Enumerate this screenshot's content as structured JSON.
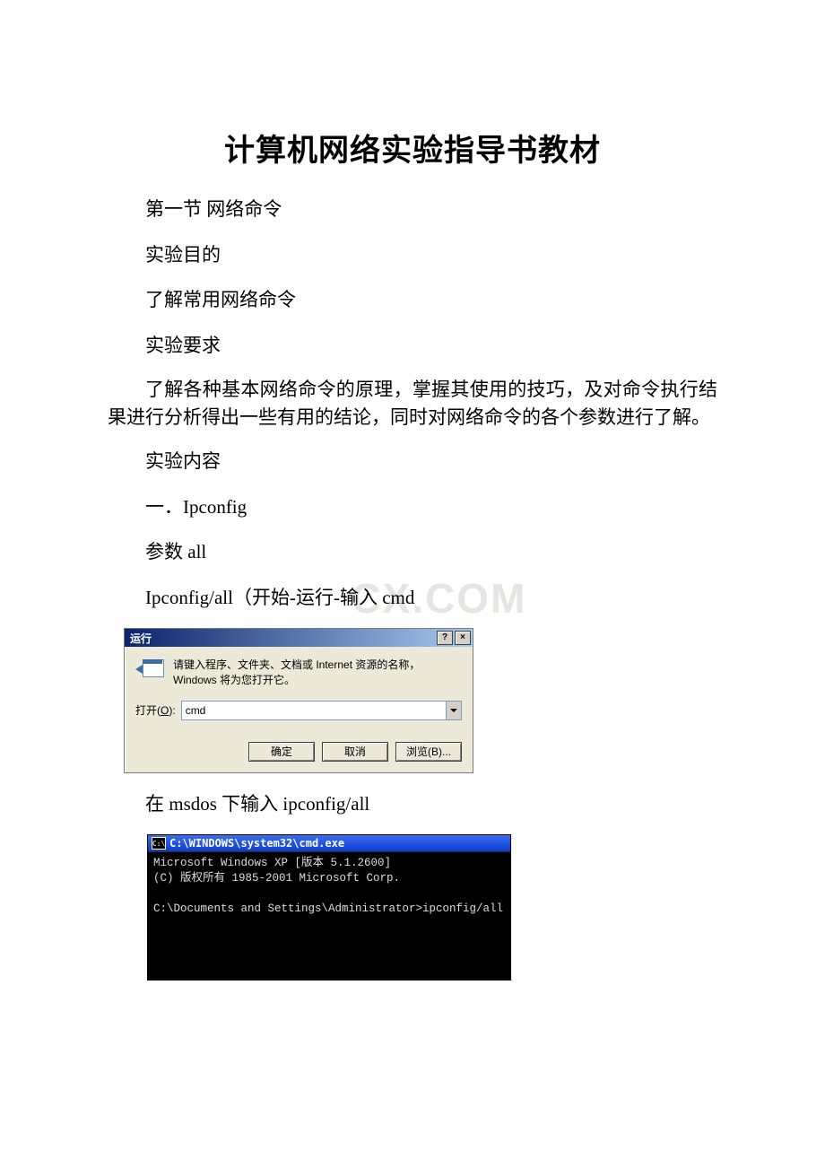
{
  "doc": {
    "title": "计算机网络实验指导书教材",
    "section": "第一节 网络命令",
    "purpose_heading": "实验目的",
    "purpose_body": " 了解常用网络命令",
    "requirement_heading": "实验要求",
    "requirement_body": " 了解各种基本网络命令的原理，掌握其使用的技巧，及对命令执行结果进行分析得出一些有用的结论，同时对网络命令的各个参数进行了解。",
    "content_heading": "实验内容",
    "item1": "一．Ipconfig",
    "param_line": "参数 all",
    "cmd_line": "Ipconfig/all（开始-运行-输入 cmd",
    "after_dialog": "在 msdos 下输入 ipconfig/all"
  },
  "watermark": "CX.COM",
  "run_dialog": {
    "title": "运行",
    "help_btn": "?",
    "close_btn": "×",
    "description": "请键入程序、文件夹、文档或 Internet 资源的名称，Windows 将为您打开它。",
    "open_label_prefix": "打开(",
    "open_label_accel": "O",
    "open_label_suffix": "):",
    "input_value": "cmd",
    "ok": "确定",
    "cancel": "取消",
    "browse": "浏览(B)..."
  },
  "cmd": {
    "icon_text": "C:\\",
    "title": "C:\\WINDOWS\\system32\\cmd.exe",
    "line1": "Microsoft Windows XP [版本 5.1.2600]",
    "line2": "(C) 版权所有 1985-2001 Microsoft Corp.",
    "blank": "",
    "line3": "C:\\Documents and Settings\\Administrator>ipconfig/all"
  }
}
